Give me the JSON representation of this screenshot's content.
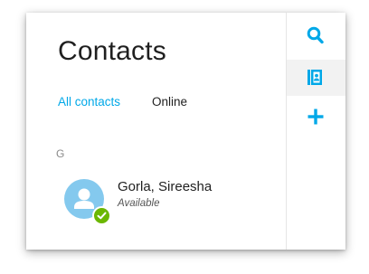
{
  "panel": {
    "title": "Contacts",
    "tabs": [
      {
        "label": "All contacts",
        "active": true
      },
      {
        "label": "Online",
        "active": false
      }
    ],
    "groups": [
      {
        "letter": "G",
        "contacts": [
          {
            "name": "Gorla, Sireesha",
            "status": "Available",
            "presence_color": "#6bb700"
          }
        ]
      }
    ]
  },
  "rail": {
    "icons": [
      "search-icon",
      "contacts-book-icon",
      "add-icon"
    ],
    "active": "contacts-book-icon"
  },
  "colors": {
    "accent": "#00a8e8",
    "avatar": "#84c9ee",
    "presence_available": "#6bb700"
  }
}
